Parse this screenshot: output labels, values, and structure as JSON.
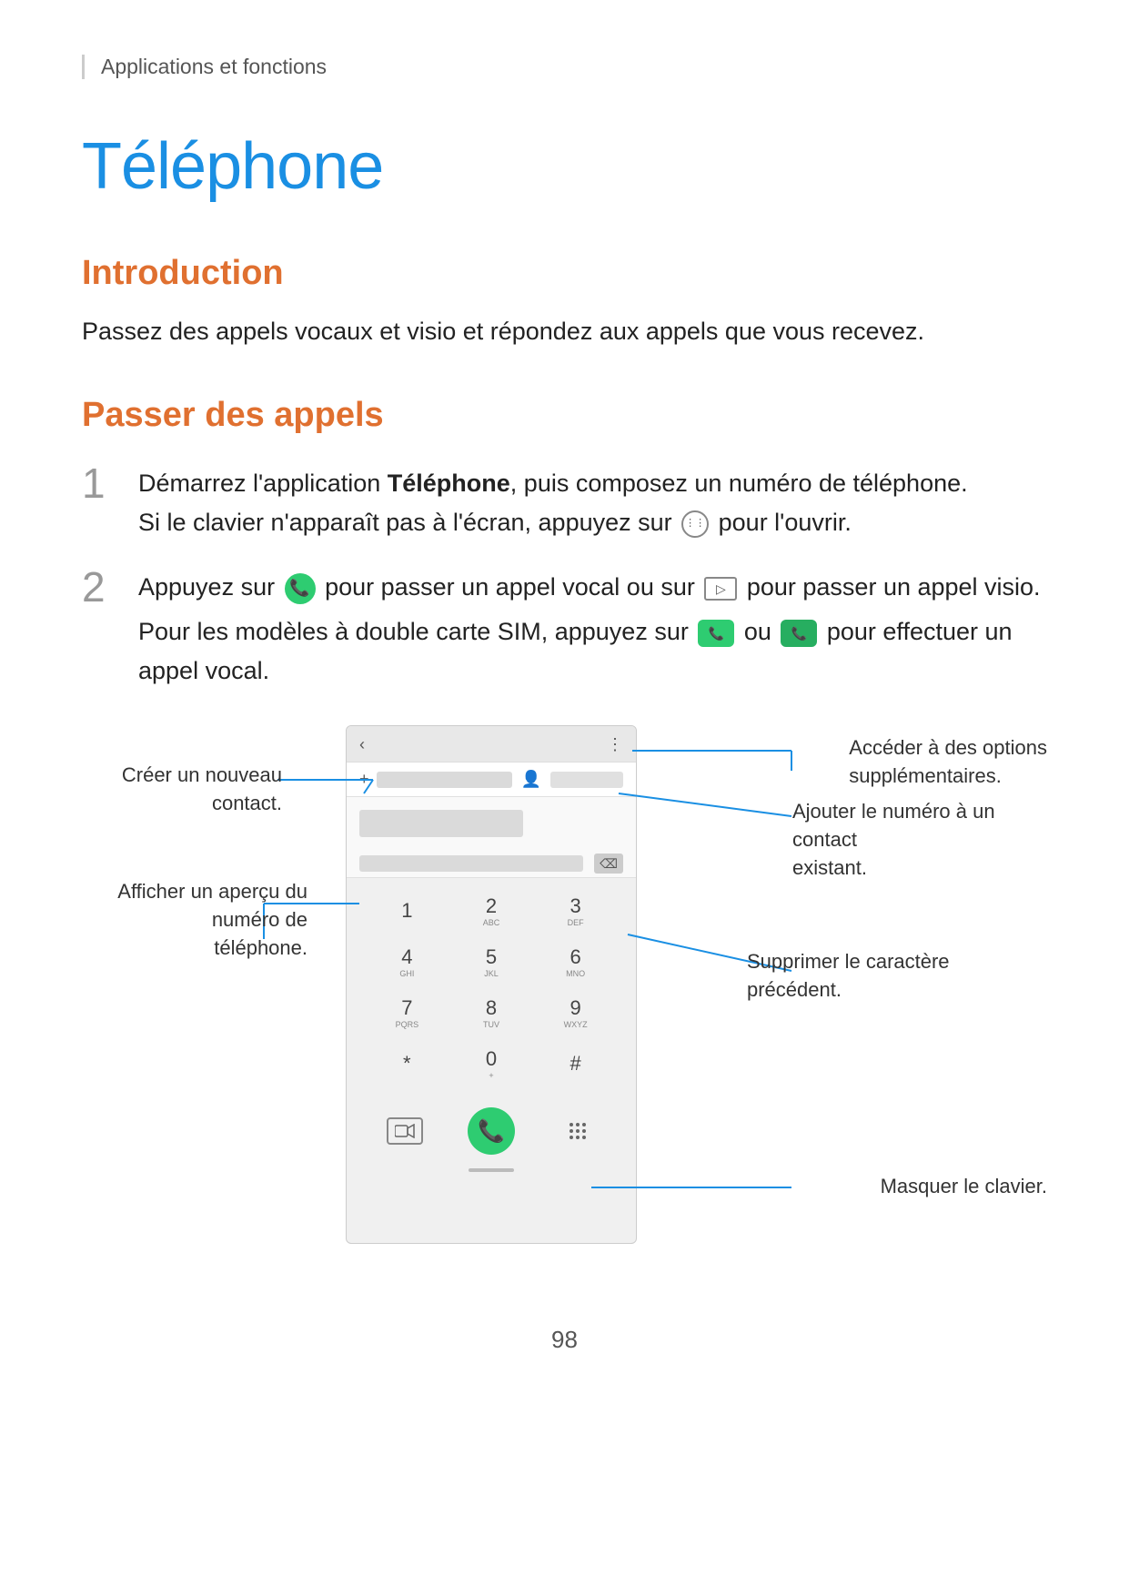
{
  "breadcrumb": {
    "text": "Applications et fonctions"
  },
  "page_title": "Téléphone",
  "sections": {
    "introduction": {
      "title": "Introduction",
      "body": "Passez des appels vocaux et visio et répondez aux appels que vous recevez."
    },
    "passer_appels": {
      "title": "Passer des appels",
      "step1": {
        "number": "1",
        "line1": "Démarrez l'application Téléphone, puis composez un numéro de téléphone.",
        "line1_bold": "Téléphone",
        "line2": "Si le clavier n'apparaît pas à l'écran, appuyez sur   pour l'ouvrir."
      },
      "step2": {
        "number": "2",
        "line1_pre": "Appuyez sur ",
        "line1_mid": " pour passer un appel vocal ou sur ",
        "line1_post": " pour passer un appel visio.",
        "line2_pre": "Pour les modèles à double carte SIM, appuyez sur ",
        "line2_mid": " ou ",
        "line2_post": " pour effectuer un appel vocal."
      }
    }
  },
  "diagram": {
    "annotations": {
      "create_contact": "Créer un nouveau contact.",
      "add_to_existing": "Ajouter le numéro à un contact\nexistant.",
      "more_options": "Accéder à des options\nsupplémentaires.",
      "show_preview": "Afficher un aperçu du numéro de\ntéléphone.",
      "delete_char": "Supprimer le caractère précédent.",
      "hide_keypad": "Masquer le clavier."
    },
    "keypad": {
      "rows": [
        [
          "1",
          "2",
          "3"
        ],
        [
          "4",
          "5",
          "6"
        ],
        [
          "7",
          "8",
          "9"
        ],
        [
          "*",
          "0",
          "#"
        ]
      ]
    }
  },
  "page_number": "98"
}
